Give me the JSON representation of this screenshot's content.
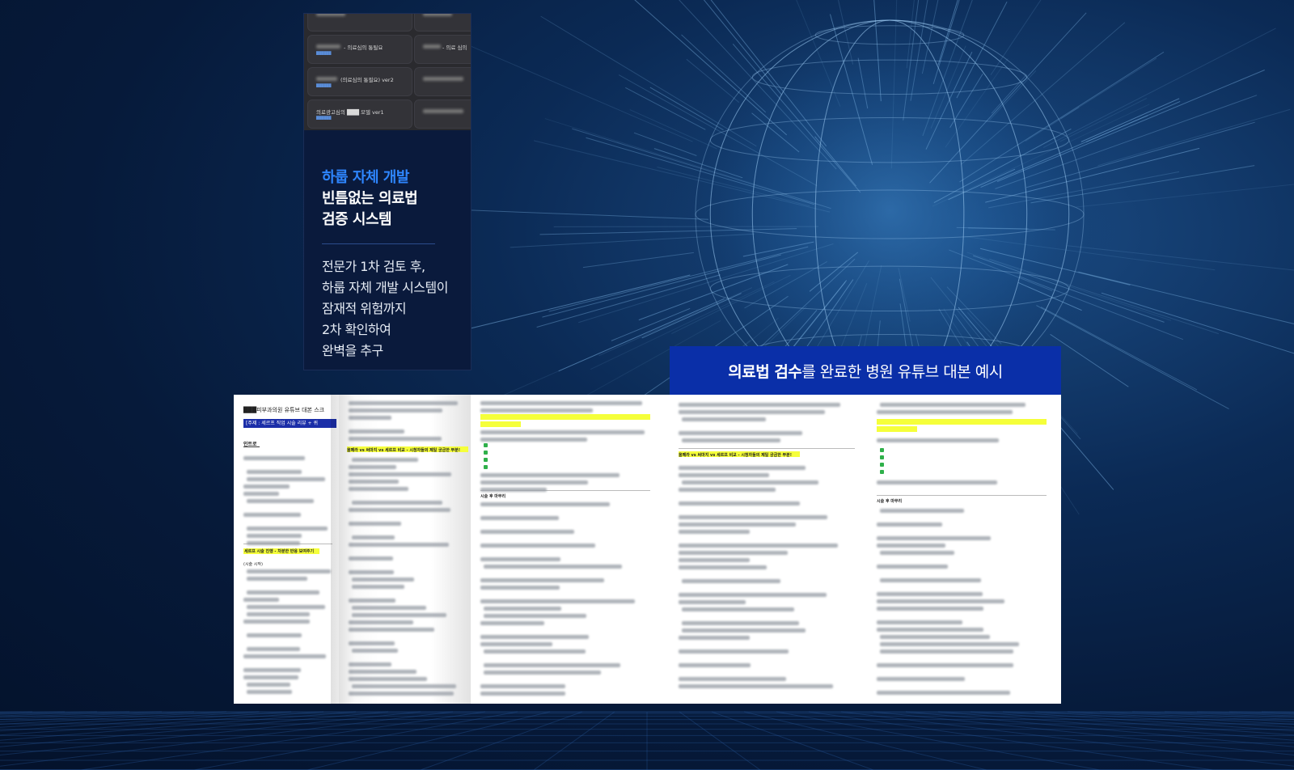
{
  "card": {
    "thumbnails": [
      {
        "title": "- 의료심의 통될요"
      },
      {
        "title": "(의료심의 통필요) ver2"
      },
      {
        "title": "의료광고심의 ███ 모델 ver1"
      },
      {
        "title": "- 의료 심의"
      }
    ],
    "heading_blue": "하룹 자체 개발",
    "heading_line2": "빈틈없는 의료법",
    "heading_line3": "검증 시스템",
    "body_lines": [
      "전문가 1차 검토 후,",
      "하룹 자체 개발 시스템이",
      "잠재적 위험까지",
      "2차 확인하여",
      "완벽을 추구"
    ]
  },
  "banner": {
    "bold": "의료법 검수",
    "rest": "를 완료한 병원 유튜브 대본 예시"
  },
  "document": {
    "title": "███피부과의원 유튜브 대본 스크",
    "topic_bar": "[주제 : 세르프 직업 시술 리뷰 + 퀴",
    "intro_label": "인트로",
    "section_label": "세르프 시술 진행 - 차분한 반응 보여주기",
    "section_note": "(시술 시작)",
    "highlight_label": "올페라 vs 써마지 vs 세르프 비교 - 시청자들의 제일 궁금한 부분!",
    "after_label": "시술 후 마무리"
  },
  "colors": {
    "accent_blue": "#2e86ff",
    "banner_blue": "#0a2fa8",
    "highlight": "#f5ff3a"
  }
}
